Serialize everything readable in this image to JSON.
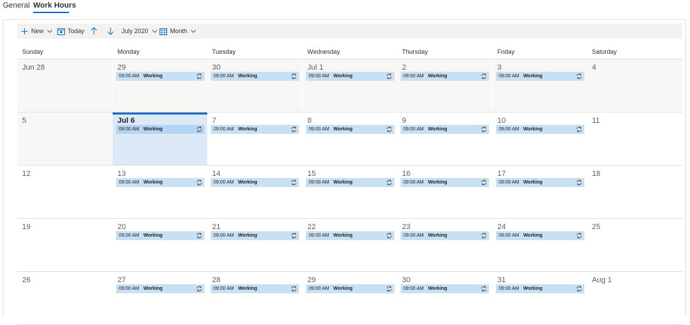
{
  "tabs": [
    {
      "label": "General",
      "active": false
    },
    {
      "label": "Work Hours",
      "active": true
    }
  ],
  "toolbar": {
    "new_label": "New",
    "today_label": "Today",
    "period_label": "July 2020",
    "view_label": "Month"
  },
  "calendar": {
    "weekdays": [
      "Sunday",
      "Monday",
      "Tuesday",
      "Wednesday",
      "Thursday",
      "Friday",
      "Saturday"
    ],
    "today": "Jul 6",
    "weeks": [
      {
        "days": [
          "Jun 28",
          "29",
          "30",
          "Jul 1",
          "2",
          "3",
          "4"
        ],
        "shaded": [
          true,
          true,
          true,
          true,
          true,
          true,
          true
        ],
        "today_index": -1
      },
      {
        "days": [
          "5",
          "Jul 6",
          "7",
          "8",
          "9",
          "10",
          "11"
        ],
        "shaded": [
          true,
          false,
          false,
          false,
          false,
          false,
          false
        ],
        "today_index": 1
      },
      {
        "days": [
          "12",
          "13",
          "14",
          "15",
          "16",
          "17",
          "18"
        ],
        "shaded": [
          false,
          false,
          false,
          false,
          false,
          false,
          false
        ],
        "today_index": -1
      },
      {
        "days": [
          "19",
          "20",
          "21",
          "22",
          "23",
          "24",
          "25"
        ],
        "shaded": [
          false,
          false,
          false,
          false,
          false,
          false,
          false
        ],
        "today_index": -1
      },
      {
        "days": [
          "26",
          "27",
          "28",
          "29",
          "30",
          "31",
          "Aug 1"
        ],
        "shaded": [
          false,
          false,
          false,
          false,
          false,
          false,
          false
        ],
        "today_index": -1
      }
    ],
    "event": {
      "time": "09:00 AM",
      "label": "Working",
      "icon": "recurring-icon"
    },
    "event_days": [
      1,
      2,
      3,
      4,
      5
    ]
  },
  "colors": {
    "accent": "#2266e3",
    "today_border": "#1e6fc3",
    "today_bg": "#dde9f7",
    "event_bg": "#c7e0f4",
    "shaded_bg": "#f8f7f6"
  }
}
